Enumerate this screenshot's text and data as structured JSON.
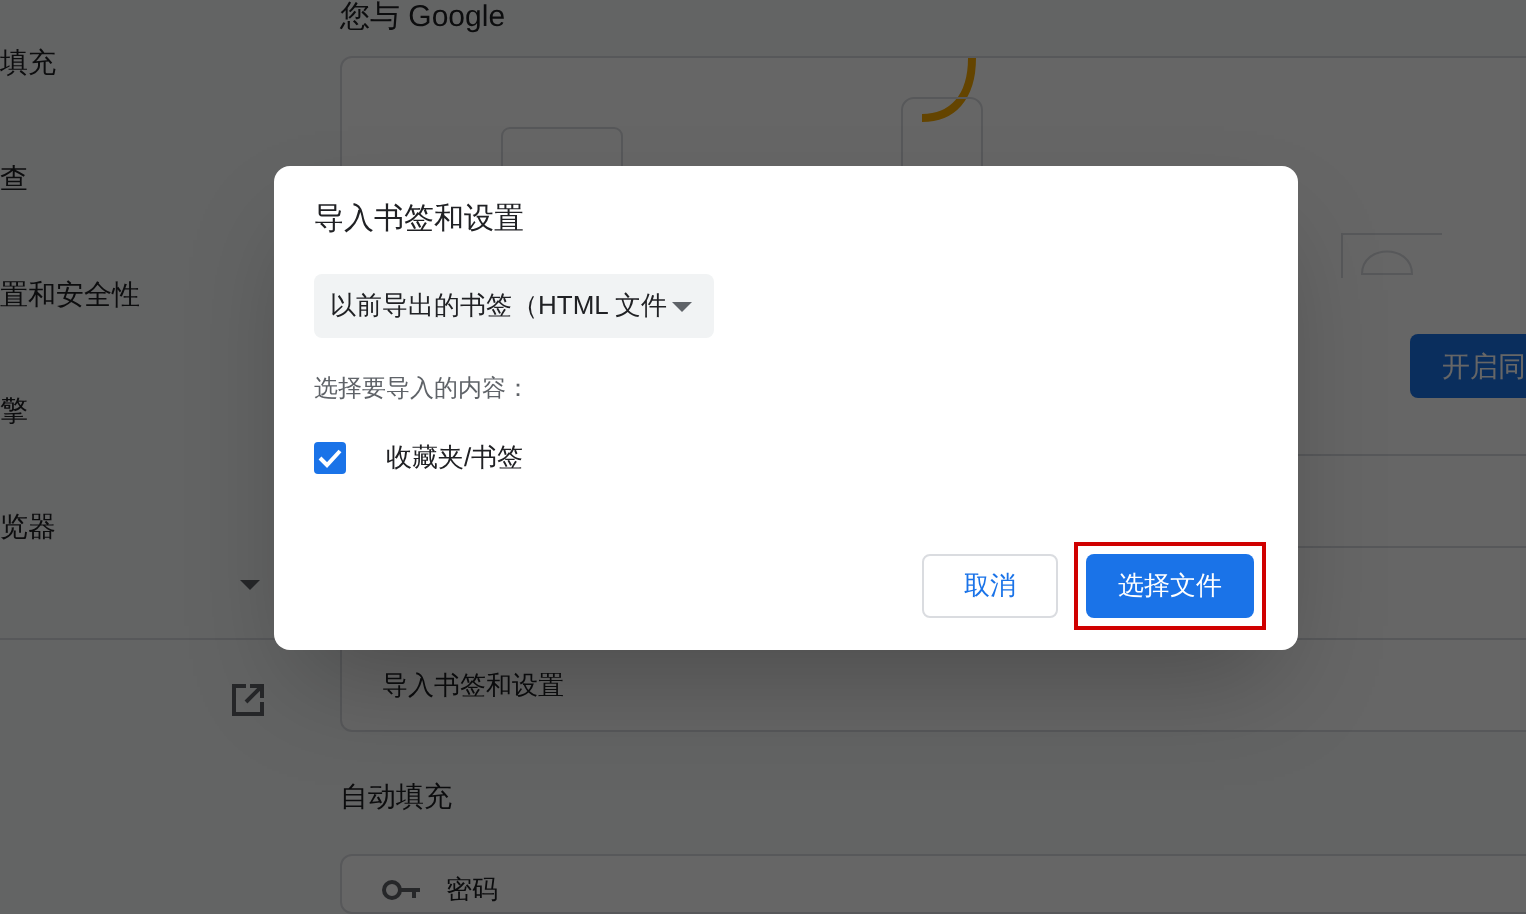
{
  "sidebar": {
    "items": [
      {
        "label": "填充"
      },
      {
        "label": "查"
      },
      {
        "label": "置和安全性"
      },
      {
        "label": "擎"
      },
      {
        "label": "览器"
      }
    ]
  },
  "main": {
    "section_title": "您与 Google",
    "sync_button": "开启同",
    "import_row": "导入书签和设置",
    "autofill_title": "自动填充",
    "password_row": "密码"
  },
  "dialog": {
    "title": "导入书签和设置",
    "source": "以前导出的书签（HTML 文件",
    "prompt": "选择要导入的内容：",
    "options": [
      {
        "label": "收藏夹/书签",
        "checked": true
      }
    ],
    "buttons": [
      {
        "label": "取消",
        "kind": "secondary",
        "highlighted": false
      },
      {
        "label": "选择文件",
        "kind": "primary",
        "highlighted": true
      }
    ]
  }
}
